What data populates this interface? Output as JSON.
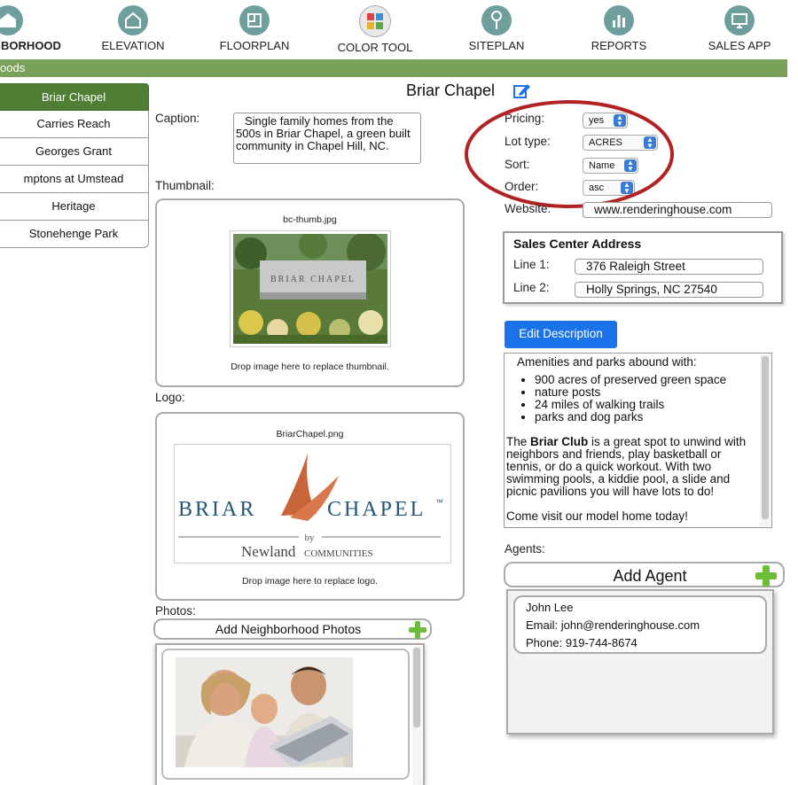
{
  "nav": {
    "items": [
      {
        "label": "BORHOOD",
        "icon": "house-icon"
      },
      {
        "label": "ELEVATION",
        "icon": "house-outline-icon"
      },
      {
        "label": "FLOORPLAN",
        "icon": "floorplan-icon"
      },
      {
        "label": "COLOR TOOL",
        "icon": "color-tool-icon"
      },
      {
        "label": "SITEPLAN",
        "icon": "map-pin-icon"
      },
      {
        "label": "REPORTS",
        "icon": "bar-chart-icon"
      },
      {
        "label": "SALES APP",
        "icon": "monitor-icon"
      }
    ]
  },
  "section_bar": "oods",
  "sidebar": {
    "items": [
      "Briar Chapel",
      "Carries Reach",
      "Georges Grant",
      "mptons at Umstead",
      "Heritage",
      "Stonehenge Park"
    ]
  },
  "page": {
    "title": "Briar Chapel"
  },
  "caption": {
    "label": "Caption:",
    "value": "Single family homes from the 500s in Briar Chapel, a green built community in Chapel Hill, NC."
  },
  "thumbnail": {
    "label": "Thumbnail:",
    "filename": "bc-thumb.jpg",
    "sign_text": "BRIAR CHAPEL",
    "drop_text": "Drop image here to replace thumbnail."
  },
  "logo": {
    "label": "Logo:",
    "filename": "BriarChapel.png",
    "word1": "BRIAR",
    "word2": "CHAPEL",
    "tm": "™",
    "by": "by",
    "newland": "Newland",
    "communities": "COMMUNITIES",
    "drop_text": "Drop image here to replace logo."
  },
  "photos": {
    "label": "Photos:",
    "add_label": "Add Neighborhood Photos"
  },
  "settings": {
    "pricing_label": "Pricing:",
    "pricing_value": "yes",
    "lot_type_label": "Lot type:",
    "lot_type_value": "ACRES",
    "sort_label": "Sort:",
    "sort_value": "Name",
    "order_label": "Order:",
    "order_value": "asc",
    "website_label": "Website:",
    "website_value": "www.renderinghouse.com"
  },
  "sales_center": {
    "title": "Sales Center Address",
    "line1_label": "Line 1:",
    "line1_value": "376 Raleigh Street",
    "line2_label": "Line 2:",
    "line2_value": "Holly Springs, NC 27540"
  },
  "description": {
    "button": "Edit Description",
    "intro": "Amenities and parks abound with:",
    "bullets": [
      "900 acres of preserved green space",
      "nature posts",
      "24 miles of walking trails",
      "parks and dog parks"
    ],
    "p_pre": "The ",
    "p_bold": "Briar Club",
    "p_post": " is a great spot to unwind with neighbors and friends, play basketball or tennis, or do a quick workout. With two swimming pools, a kiddie pool, a slide and picnic pavilions you will have lots to do!",
    "closing": "Come visit our model home today!"
  },
  "agents": {
    "label": "Agents:",
    "add_label": "Add Agent",
    "list": [
      {
        "name": "John Lee",
        "email": "Email: john@renderinghouse.com",
        "phone": "Phone: 919-744-8674"
      }
    ]
  },
  "colors": {
    "accent_green": "#7aa15a",
    "active_green": "#4f7f35",
    "button_blue": "#1a73e8",
    "circle_red": "#b22222"
  }
}
